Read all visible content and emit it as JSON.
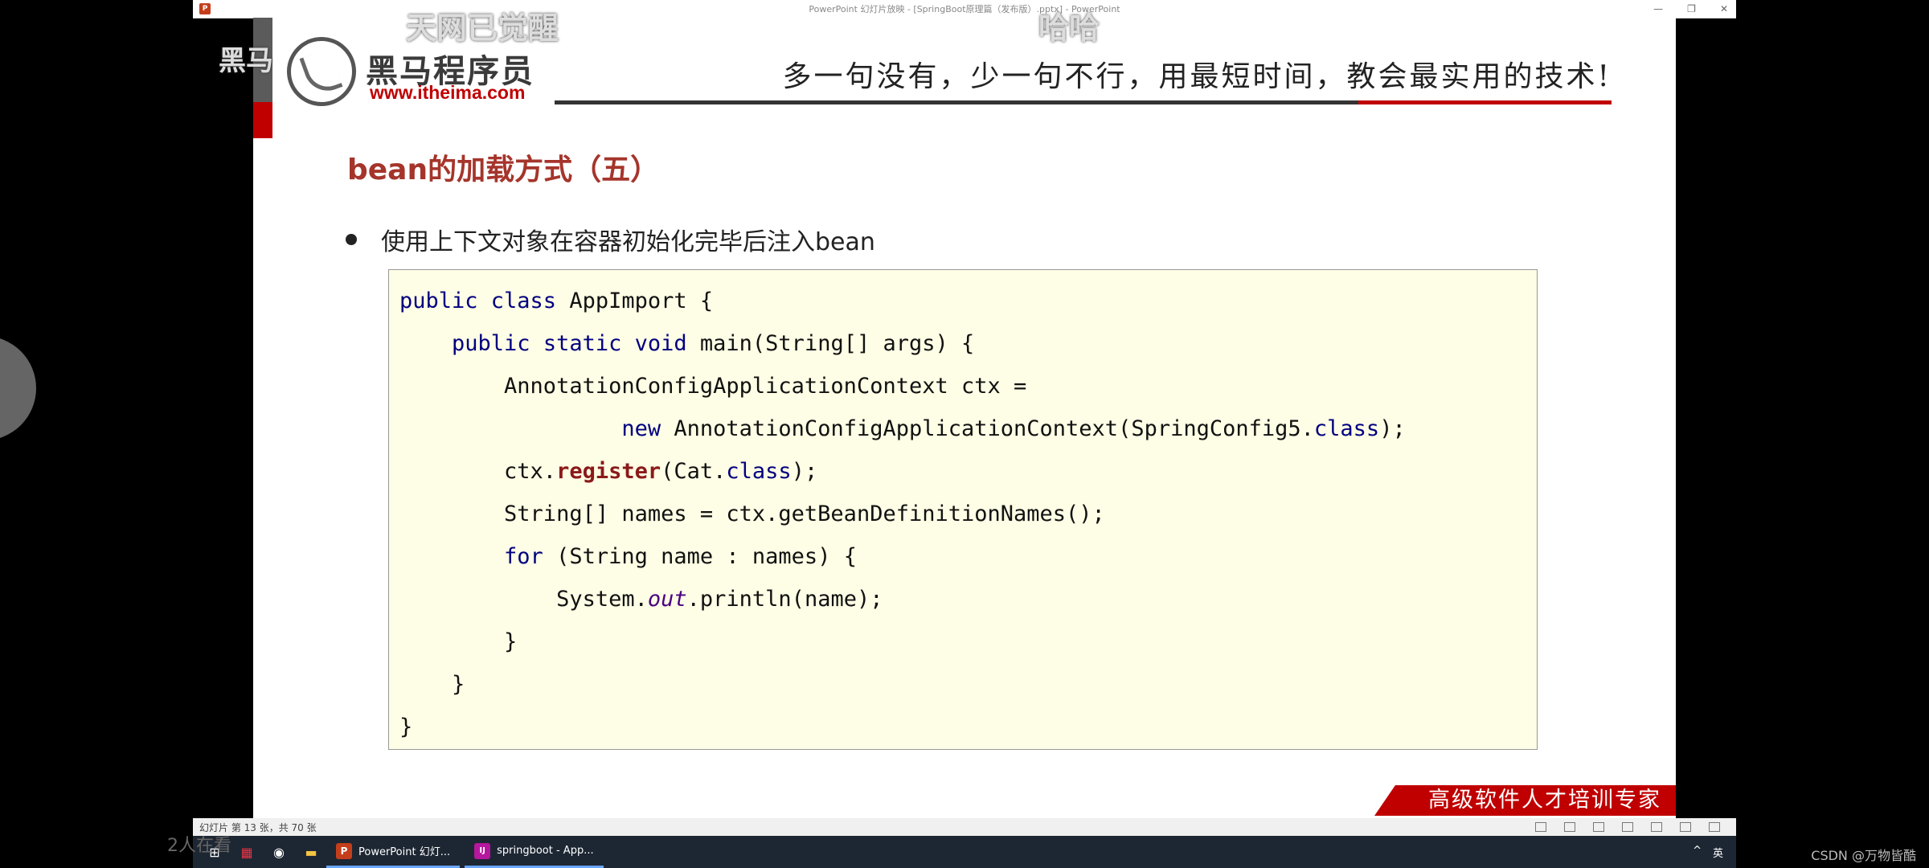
{
  "window": {
    "title": "PowerPoint 幻灯片放映 - [SpringBoot原理篇（发布版）.pptx] - PowerPoint",
    "controls": [
      "—",
      "❐",
      "✕"
    ]
  },
  "slide": {
    "logo": {
      "name": "黑马程序员",
      "url": "www.itheima.com"
    },
    "slogan": "多一句没有，少一句不行，用最短时间，教会最实用的技术!",
    "title": "bean的加载方式（五）",
    "bullet": "使用上下文对象在容器初始化完毕后注入bean",
    "code": {
      "l1_kw": "public class",
      "l1_rest": " AppImport {",
      "l2_indent": "    ",
      "l2_kw": "public static void",
      "l2_rest": " main(String[] args) {",
      "l3": "        AnnotationConfigApplicationContext ctx =",
      "l4_indent": "                 ",
      "l4_kw": "new",
      "l4_mid": " AnnotationConfigApplicationContext(SpringConfig5.",
      "l4_kw2": "class",
      "l4_end": ");",
      "l5_start": "        ctx.",
      "l5_register": "register",
      "l5_mid": "(Cat.",
      "l5_kw": "class",
      "l5_end": ");",
      "l6": "        String[] names = ctx.getBeanDefinitionNames();",
      "l7_indent": "        ",
      "l7_kw": "for",
      "l7_rest": " (String name : names) {",
      "l8_start": "            System.",
      "l8_out": "out",
      "l8_end": ".println(name);",
      "l9": "        }",
      "l10": "    }",
      "l11": "}"
    },
    "footer_banner": "高级软件人才培训专家"
  },
  "overlays": {
    "top_left_watermark": "黑马",
    "top_comment_1": "天网已觉醒",
    "top_comment_2": "哈哈"
  },
  "status_bar": {
    "slide_info": "幻灯片 第 13 张，共 70 张"
  },
  "taskbar": {
    "apps": [
      {
        "label": "PowerPoint 幻灯...",
        "icon": "P",
        "color": "#c43e1c"
      },
      {
        "label": "springboot - App...",
        "icon": "IJ",
        "color": "#b5179e"
      }
    ],
    "tray_text": "英"
  },
  "viewers_text": "2人在看",
  "watermark": "CSDN @万物皆酷",
  "colors": {
    "title_red": "#a5352b",
    "brand_red": "#c00000",
    "code_bg": "#fefde5",
    "keyword_blue": "#000080"
  }
}
